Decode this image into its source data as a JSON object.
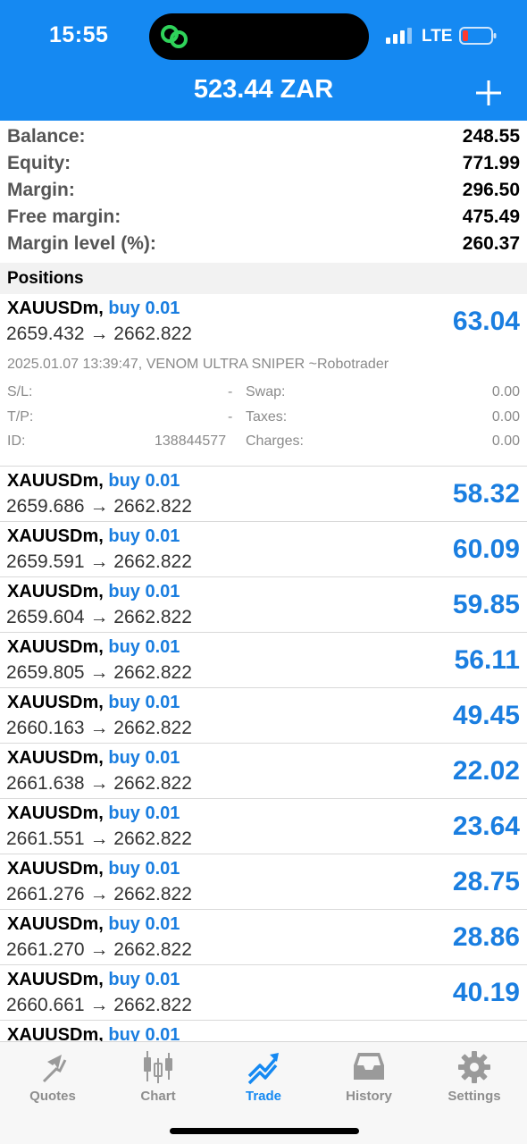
{
  "status_bar": {
    "time": "15:55",
    "network": "LTE"
  },
  "header": {
    "title": "523.44 ZAR"
  },
  "summary": [
    {
      "label": "Balance:",
      "value": "248.55"
    },
    {
      "label": "Equity:",
      "value": "771.99"
    },
    {
      "label": "Margin:",
      "value": "296.50"
    },
    {
      "label": "Free margin:",
      "value": "475.49"
    },
    {
      "label": "Margin level (%):",
      "value": "260.37"
    }
  ],
  "positions_title": "Positions",
  "arrow": "→",
  "positions": [
    {
      "symbol": "XAUUSDm,",
      "side": "buy 0.01",
      "open": "2659.432",
      "current": "2662.822",
      "profit": "63.04"
    },
    {
      "symbol": "XAUUSDm,",
      "side": "buy 0.01",
      "open": "2659.686",
      "current": "2662.822",
      "profit": "58.32"
    },
    {
      "symbol": "XAUUSDm,",
      "side": "buy 0.01",
      "open": "2659.591",
      "current": "2662.822",
      "profit": "60.09"
    },
    {
      "symbol": "XAUUSDm,",
      "side": "buy 0.01",
      "open": "2659.604",
      "current": "2662.822",
      "profit": "59.85"
    },
    {
      "symbol": "XAUUSDm,",
      "side": "buy 0.01",
      "open": "2659.805",
      "current": "2662.822",
      "profit": "56.11"
    },
    {
      "symbol": "XAUUSDm,",
      "side": "buy 0.01",
      "open": "2660.163",
      "current": "2662.822",
      "profit": "49.45"
    },
    {
      "symbol": "XAUUSDm,",
      "side": "buy 0.01",
      "open": "2661.638",
      "current": "2662.822",
      "profit": "22.02"
    },
    {
      "symbol": "XAUUSDm,",
      "side": "buy 0.01",
      "open": "2661.551",
      "current": "2662.822",
      "profit": "23.64"
    },
    {
      "symbol": "XAUUSDm,",
      "side": "buy 0.01",
      "open": "2661.276",
      "current": "2662.822",
      "profit": "28.75"
    },
    {
      "symbol": "XAUUSDm,",
      "side": "buy 0.01",
      "open": "2661.270",
      "current": "2662.822",
      "profit": "28.86"
    },
    {
      "symbol": "XAUUSDm,",
      "side": "buy 0.01",
      "open": "2660.661",
      "current": "2662.822",
      "profit": "40.19"
    },
    {
      "symbol": "XAUUSDm,",
      "side": "buy 0.01"
    }
  ],
  "expanded": {
    "meta": "2025.01.07 13:39:47, VENOM ULTRA SNIPER  ~Robotrader",
    "sl_label": "S/L:",
    "sl_value": "-",
    "tp_label": "T/P:",
    "tp_value": "-",
    "id_label": "ID:",
    "id_value": "138844577",
    "swap_label": "Swap:",
    "swap_value": "0.00",
    "taxes_label": "Taxes:",
    "taxes_value": "0.00",
    "charges_label": "Charges:",
    "charges_value": "0.00"
  },
  "tabs": [
    {
      "label": "Quotes",
      "icon": "quotes-icon"
    },
    {
      "label": "Chart",
      "icon": "chart-candles-icon"
    },
    {
      "label": "Trade",
      "icon": "trade-icon",
      "active": true
    },
    {
      "label": "History",
      "icon": "history-inbox-icon"
    },
    {
      "label": "Settings",
      "icon": "gear-icon"
    }
  ],
  "colors": {
    "accent": "#1589f2",
    "profit": "#1a7ee0",
    "header_bg": "#1589f2"
  }
}
